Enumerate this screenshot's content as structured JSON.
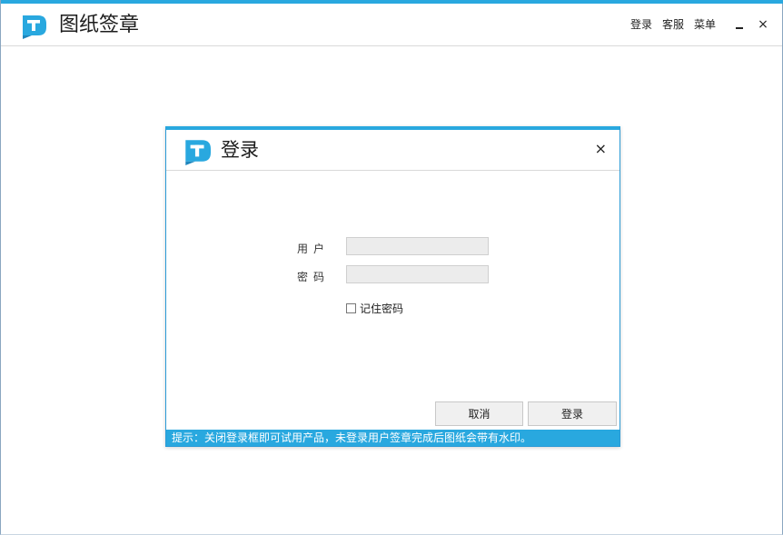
{
  "app": {
    "title": "图纸签章",
    "brand_color": "#29a8df",
    "logo_icon": "app-logo-t-icon"
  },
  "top_menu": {
    "login": "登录",
    "support": "客服",
    "menu": "菜单",
    "minimize_icon": "minimize-icon",
    "close_glyph": "×"
  },
  "login_dialog": {
    "title": "登录",
    "close_glyph": "×",
    "username_label": "用户",
    "password_label": "密码",
    "username_value": "",
    "password_value": "",
    "remember_label": "记住密码",
    "remember_checked": false,
    "cancel_button": "取消",
    "login_button": "登录",
    "hint": "提示：关闭登录框即可试用产品，未登录用户签章完成后图纸会带有水印。"
  }
}
